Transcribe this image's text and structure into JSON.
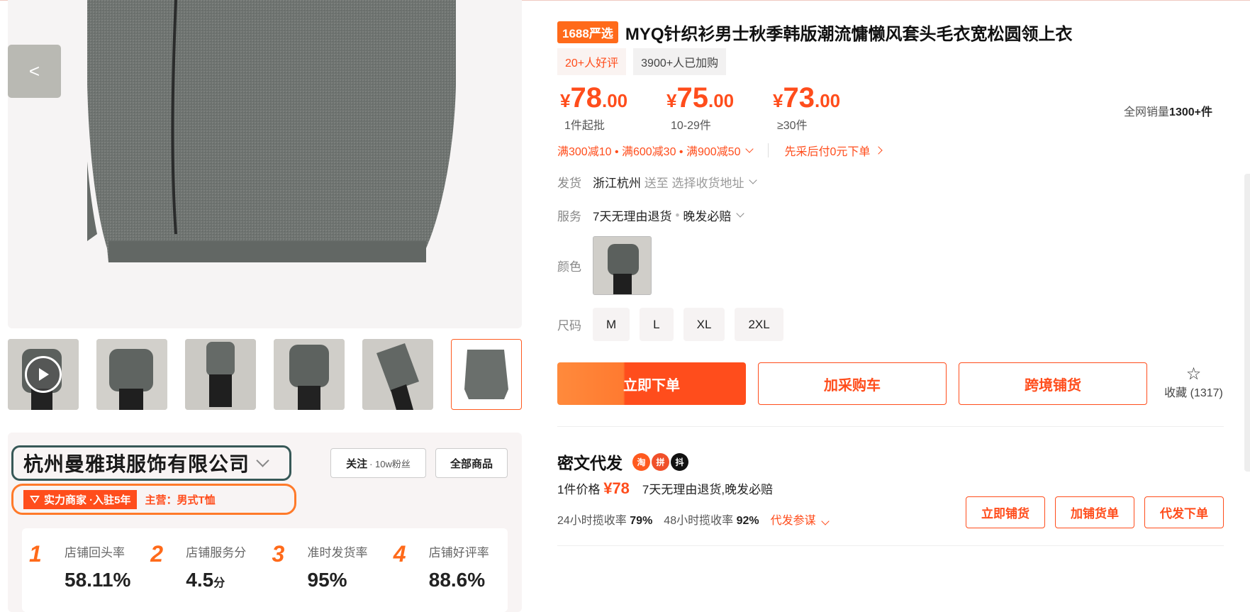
{
  "gallery": {
    "prev_label": "<",
    "thumbnails": [
      "video-thumb",
      "photo-2",
      "photo-3",
      "photo-4",
      "photo-5",
      "photo-6-selected"
    ]
  },
  "shop": {
    "name": "杭州曼雅琪服饰有限公司",
    "badge": "实力商家 ·入驻5年",
    "main_business": "主营：男式T恤",
    "follow_label": "关注",
    "fans": "· 10w粉丝",
    "all_products_label": "全部商品",
    "stats": [
      {
        "rank": "1",
        "label": "店铺回头率",
        "value": "58.11%",
        "unit": ""
      },
      {
        "rank": "2",
        "label": "店铺服务分",
        "value": "4.5",
        "unit": "分"
      },
      {
        "rank": "3",
        "label": "准时发货率",
        "value": "95%",
        "unit": ""
      },
      {
        "rank": "4",
        "label": "店铺好评率",
        "value": "88.6%",
        "unit": ""
      }
    ]
  },
  "product": {
    "badge": "1688严选",
    "title": "MYQ针织衫男士秋季韩版潮流慵懒风套头毛衣宽松圆领上衣",
    "tags": [
      "20+人好评",
      "3900+人已加购"
    ],
    "prices": [
      {
        "currency": "¥",
        "int": "78",
        "dec": ".00",
        "qty": "1件起批"
      },
      {
        "currency": "¥",
        "int": "75",
        "dec": ".00",
        "qty": "10-29件"
      },
      {
        "currency": "¥",
        "int": "73",
        "dec": ".00",
        "qty": "≥30件"
      }
    ],
    "total_sales_prefix": "全网销量",
    "total_sales_value": "1300+件",
    "promo": "满300减10 • 满600减30 • 满900减50",
    "pay_later": "先采后付0元下单",
    "ship_key": "发货",
    "ship_from": "浙江杭州",
    "ship_to_prefix": "送至",
    "ship_to": "选择收货地址",
    "service_key": "服务",
    "service_1": "7天无理由退货",
    "service_2": "晚发必赔",
    "color_key": "颜色",
    "size_key": "尺码",
    "sizes": [
      "M",
      "L",
      "XL",
      "2XL"
    ],
    "buy_now": "立即下单",
    "add_cart": "加采购车",
    "cross_border": "跨境铺货",
    "fav_label": "收藏",
    "fav_count": "(1317)"
  },
  "dropship": {
    "title": "密文代发",
    "platforms": [
      "淘",
      "拼",
      "抖"
    ],
    "price_label": "1件价格",
    "price": "¥78",
    "service": "7天无理由退货,晚发必赔",
    "rate24_label": "24小时揽收率",
    "rate24": "79%",
    "rate48_label": "48小时揽收率",
    "rate48": "92%",
    "params": "代发参谋",
    "btn_list": "立即铺货",
    "btn_add": "加铺货单",
    "btn_order": "代发下单"
  },
  "colors": {
    "accent": "#ff4d1c",
    "shop_box": "#375857",
    "badge_box": "#ff7a2a"
  }
}
